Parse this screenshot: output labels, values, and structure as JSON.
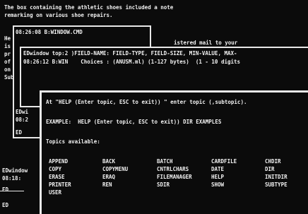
{
  "background_text": {
    "line1": "The box containing the athletic shoes included a note",
    "line2": "remarking on various shoe repairs.",
    "left_fragments": [
      "He",
      "is",
      "pr",
      "of",
      "on",
      "Sub"
    ]
  },
  "window1": {
    "title": "08:26:08 B:WINDOW.CMD",
    "right_text": "istered mail to your",
    "left_rows": [
      "EDwi",
      "08:2",
      "",
      "ED"
    ]
  },
  "window2": {
    "line1": "EDwindow top:2 )FIELD-NAME: FIELD-TYPE, FIELD-SIZE, MIN-VALUE, MAX-",
    "line2": "08:26:12 B:WIN    Choices : (ANUSM.ml) (1-127 bytes)  (1 - 10 digits",
    "bottom_left": [
      "EDwindow",
      "08:18:",
      "ED",
      "ED"
    ]
  },
  "help_window": {
    "prompt": "At \"HELP (Enter topic, ESC to exit)) \" enter topic (,subtopic).",
    "example": "EXAMPLE:  HELP (Enter topic, ESC to exit)) DIR EXAMPLES",
    "topics_heading": "Topics available:",
    "topics": [
      [
        "APPEND",
        "BACK",
        "BATCH",
        "CARDFILE",
        "CHDIR"
      ],
      [
        "COPY",
        "COPYMENU",
        "CNTRLCHARS",
        "DATE",
        "DIR"
      ],
      [
        "ERASE",
        "ERAQ",
        "FILEMANAGER",
        "HELP",
        "INITDIR"
      ],
      [
        "PRINTER",
        "REN",
        "SDIR",
        "SHOW",
        "SUBTYPE"
      ],
      [
        "USER",
        "",
        "",
        "",
        ""
      ]
    ]
  },
  "colors": {
    "background": "#0b0b0b",
    "text": "#f2f2f2",
    "border": "#e8e8e8"
  }
}
